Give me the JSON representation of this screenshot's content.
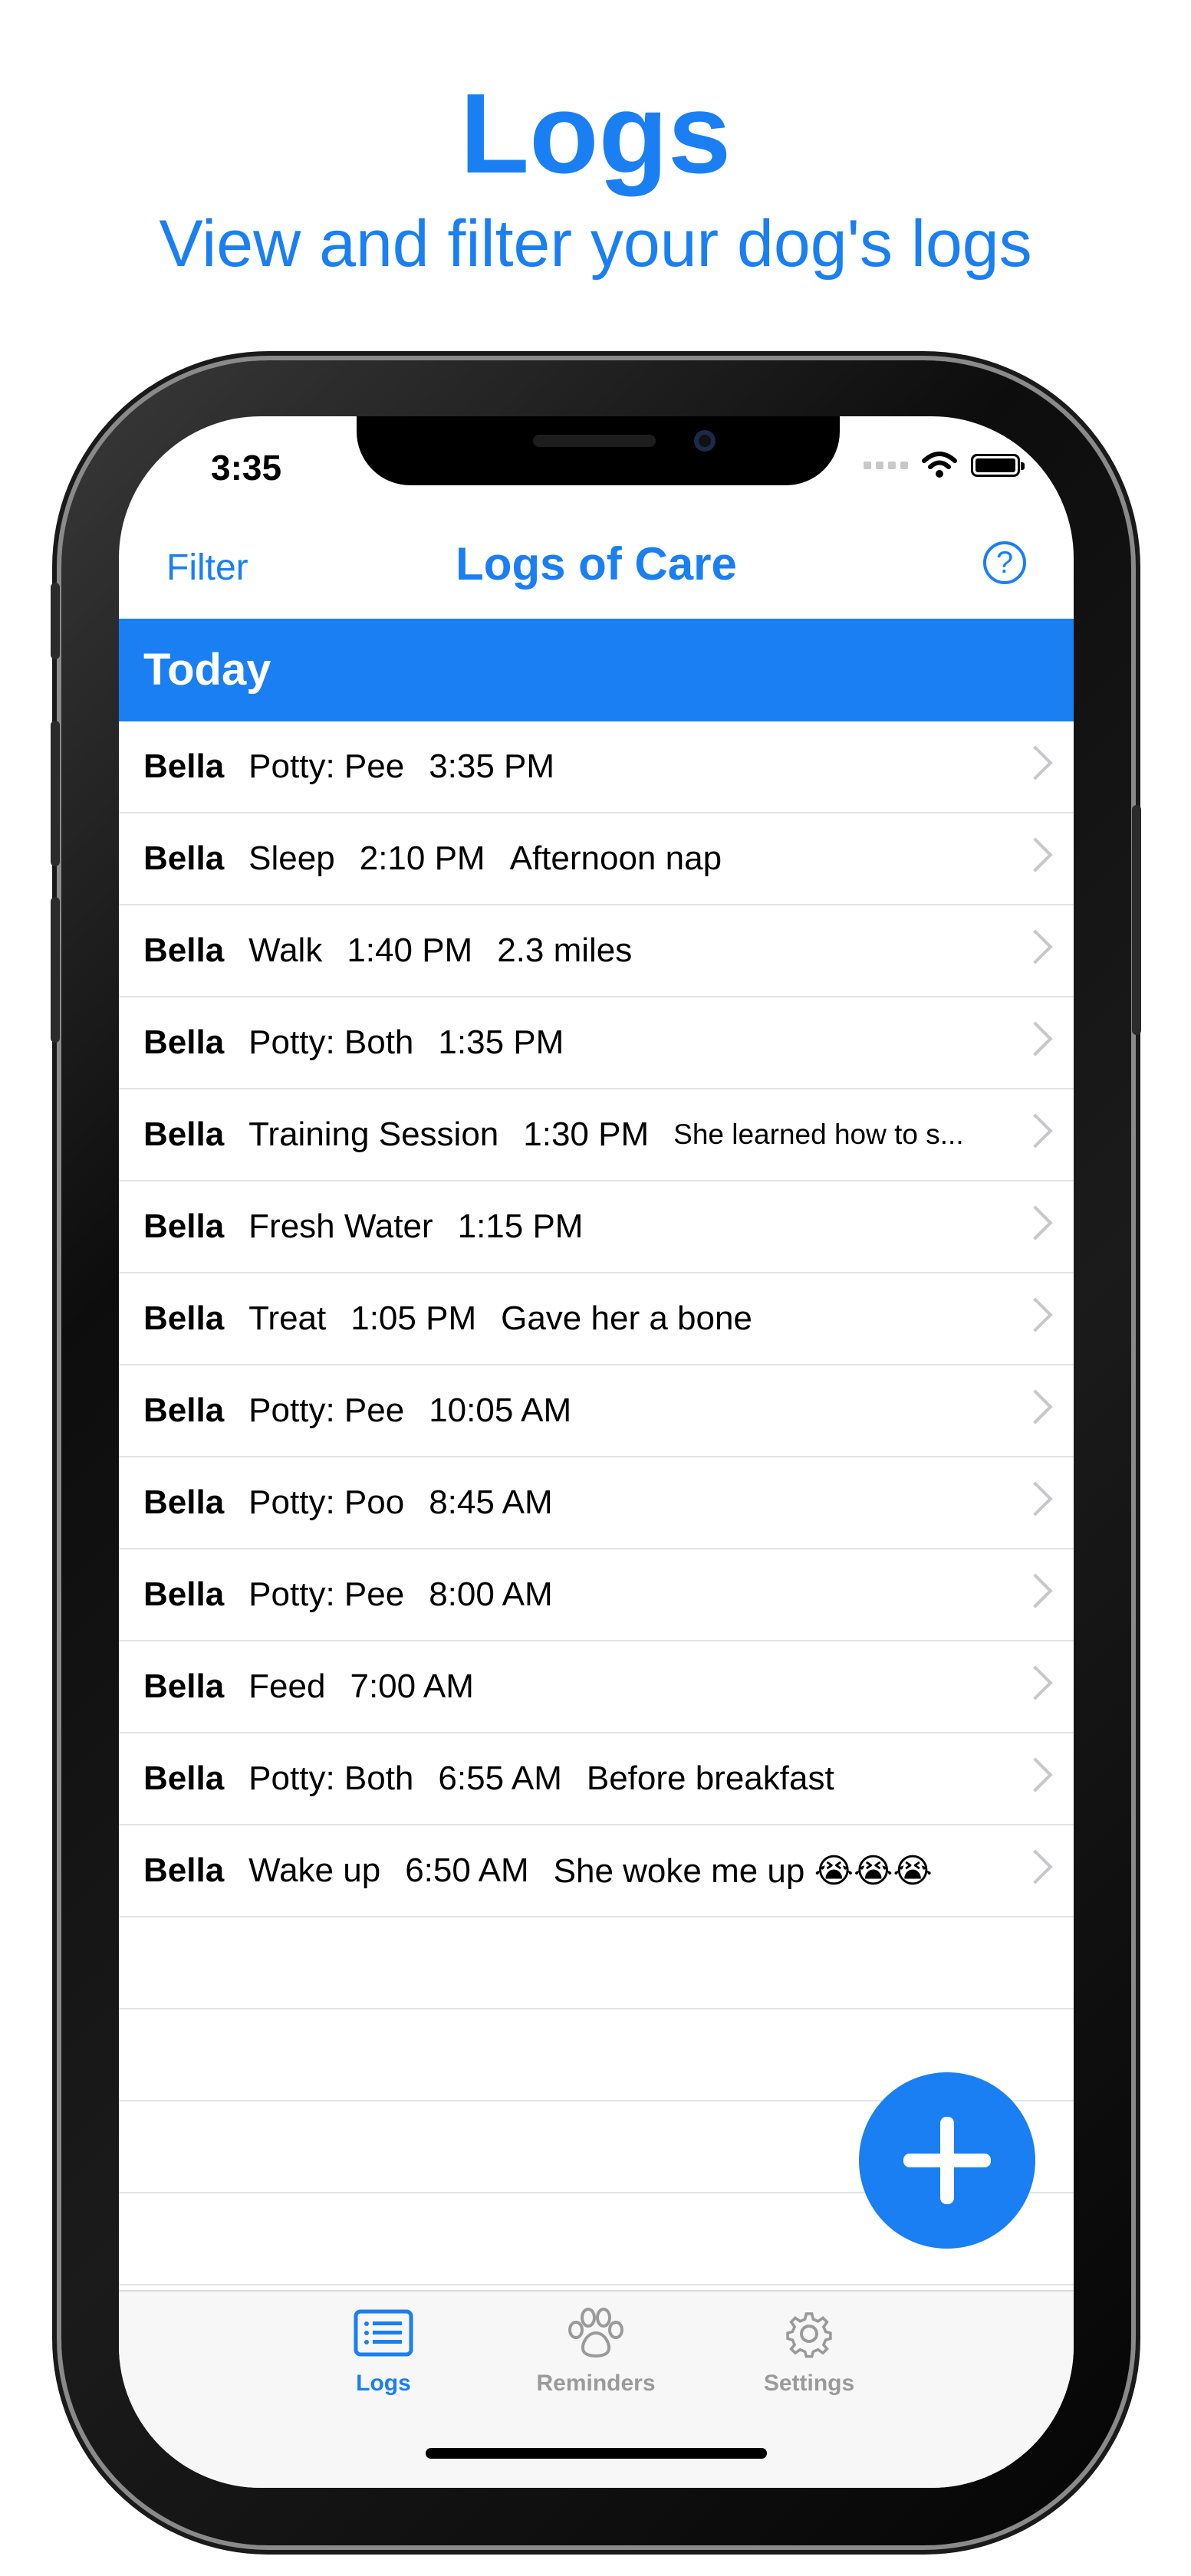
{
  "hero": {
    "title": "Logs",
    "subtitle": "View and filter your dog's logs"
  },
  "status_bar": {
    "time": "3:35"
  },
  "nav": {
    "filter_label": "Filter",
    "title": "Logs of Care",
    "help_label": "?"
  },
  "section": {
    "title": "Today"
  },
  "logs": [
    {
      "name": "Bella",
      "type": "Potty: Pee",
      "time": "3:35 PM",
      "note": ""
    },
    {
      "name": "Bella",
      "type": "Sleep",
      "time": "2:10 PM",
      "note": "Afternoon nap"
    },
    {
      "name": "Bella",
      "type": "Walk",
      "time": "1:40 PM",
      "note": "2.3 miles"
    },
    {
      "name": "Bella",
      "type": "Potty: Both",
      "time": "1:35 PM",
      "note": ""
    },
    {
      "name": "Bella",
      "type": "Training Session",
      "time": "1:30 PM",
      "note": "She learned how to s..."
    },
    {
      "name": "Bella",
      "type": "Fresh Water",
      "time": "1:15 PM",
      "note": ""
    },
    {
      "name": "Bella",
      "type": "Treat",
      "time": "1:05 PM",
      "note": "Gave her a bone"
    },
    {
      "name": "Bella",
      "type": "Potty: Pee",
      "time": "10:05 AM",
      "note": ""
    },
    {
      "name": "Bella",
      "type": "Potty: Poo",
      "time": "8:45 AM",
      "note": ""
    },
    {
      "name": "Bella",
      "type": "Potty: Pee",
      "time": "8:00 AM",
      "note": ""
    },
    {
      "name": "Bella",
      "type": "Feed",
      "time": "7:00 AM",
      "note": ""
    },
    {
      "name": "Bella",
      "type": "Potty: Both",
      "time": "6:55 AM",
      "note": "Before breakfast"
    },
    {
      "name": "Bella",
      "type": "Wake up",
      "time": "6:50 AM",
      "note": "She woke me up 😭😭😭"
    }
  ],
  "tabs": [
    {
      "label": "Logs",
      "icon": "list-icon",
      "active": true
    },
    {
      "label": "Reminders",
      "icon": "paw-icon",
      "active": false
    },
    {
      "label": "Settings",
      "icon": "gear-icon",
      "active": false
    }
  ],
  "colors": {
    "accent": "#1a7ff2",
    "inactive_tab": "#9a9a9a",
    "separator": "#e4e4e4"
  }
}
